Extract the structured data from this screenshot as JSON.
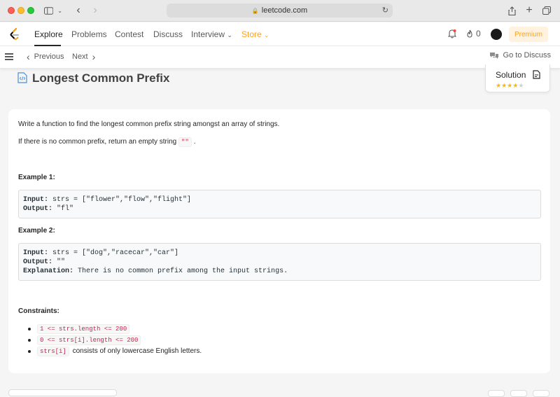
{
  "browser": {
    "url": "leetcode.com"
  },
  "nav": {
    "items": [
      "Explore",
      "Problems",
      "Contest",
      "Discuss",
      "Interview",
      "Store"
    ],
    "fire_count": "0",
    "premium": "Premium"
  },
  "subnav": {
    "previous": "Previous",
    "next": "Next",
    "go_to_discuss": "Go to Discuss"
  },
  "problem": {
    "title": "Longest Common Prefix",
    "solution_label": "Solution",
    "rating_stars": 4,
    "rating_max": 5,
    "desc_1": "Write a function to find the longest common prefix string amongst an array of strings.",
    "desc_2_pre": "If there is no common prefix, return an empty string ",
    "desc_2_code": "\"\"",
    "desc_2_post": ".",
    "example1_heading": "Example 1:",
    "example1_input_label": "Input:",
    "example1_input": " strs = [\"flower\",\"flow\",\"flight\"]",
    "example1_output_label": "Output:",
    "example1_output": " \"fl\"",
    "example2_heading": "Example 2:",
    "example2_input_label": "Input:",
    "example2_input": " strs = [\"dog\",\"racecar\",\"car\"]",
    "example2_output_label": "Output:",
    "example2_output": " \"\"",
    "example2_explanation_label": "Explanation:",
    "example2_explanation": " There is no common prefix among the input strings.",
    "constraints_heading": "Constraints:",
    "constraint_1": "1 <= strs.length <= 200",
    "constraint_2": "0 <= strs[i].length <= 200",
    "constraint_3_code": "strs[i]",
    "constraint_3_text": " consists of only lowercase English letters."
  },
  "colors": {
    "accent": "#ffa116",
    "inline_code": "#c7254e",
    "star": "#ffb800"
  }
}
